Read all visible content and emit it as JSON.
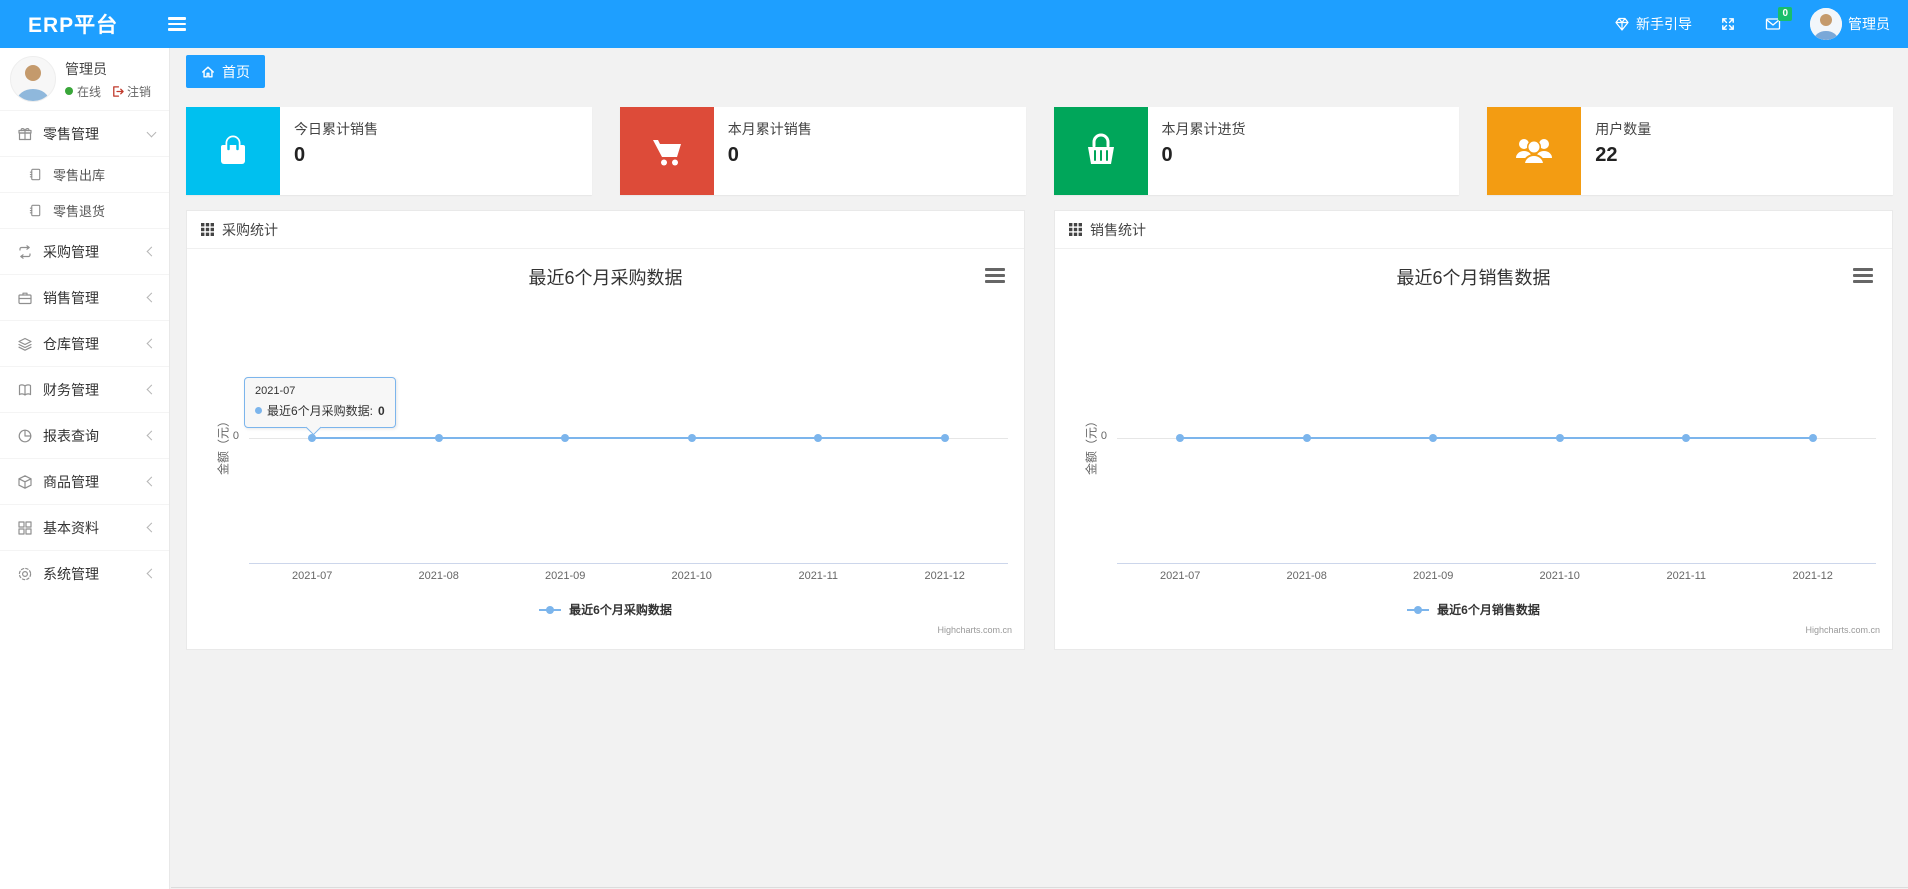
{
  "navbar": {
    "brand": "ERP平台",
    "guide_label": "新手引导",
    "message_badge": "0",
    "user_name": "管理员"
  },
  "sidebar": {
    "user": {
      "name": "管理员",
      "online_label": "在线",
      "logout_label": "注销"
    },
    "menu": [
      {
        "label": "零售管理",
        "icon": "gift-icon",
        "expanded": true
      },
      {
        "label": "零售出库",
        "icon": "document-icon"
      },
      {
        "label": "零售退货",
        "icon": "document-icon"
      },
      {
        "label": "采购管理",
        "icon": "repeat-icon"
      },
      {
        "label": "销售管理",
        "icon": "briefcase-icon"
      },
      {
        "label": "仓库管理",
        "icon": "layers-icon"
      },
      {
        "label": "财务管理",
        "icon": "book-icon"
      },
      {
        "label": "报表查询",
        "icon": "pie-chart-icon"
      },
      {
        "label": "商品管理",
        "icon": "package-icon"
      },
      {
        "label": "基本资料",
        "icon": "grid-icon"
      },
      {
        "label": "系统管理",
        "icon": "gear-icon"
      }
    ]
  },
  "tabs": {
    "home": "首页"
  },
  "stat_cards": [
    {
      "label": "今日累计销售",
      "value": "0",
      "color": "#00c0ef",
      "icon": "shopping-bag-icon"
    },
    {
      "label": "本月累计销售",
      "value": "0",
      "color": "#dd4b39",
      "icon": "shopping-cart-icon"
    },
    {
      "label": "本月累计进货",
      "value": "0",
      "color": "#00a65a",
      "icon": "shopping-basket-icon"
    },
    {
      "label": "用户数量",
      "value": "22",
      "color": "#f39c12",
      "icon": "users-icon"
    }
  ],
  "panels": [
    {
      "title": "采购统计"
    },
    {
      "title": "销售统计"
    }
  ],
  "chart_data": [
    {
      "type": "line",
      "title": "最近6个月采购数据",
      "categories": [
        "2021-07",
        "2021-08",
        "2021-09",
        "2021-10",
        "2021-11",
        "2021-12"
      ],
      "series": [
        {
          "name": "最近6个月采购数据",
          "values": [
            0,
            0,
            0,
            0,
            0,
            0
          ],
          "color": "#7cb5ec"
        }
      ],
      "ylabel": "金额（元）",
      "ytick": "0",
      "grid": true,
      "legend_position": "bottom",
      "credit": "Highcharts.com.cn",
      "tooltip": {
        "header": "2021-07",
        "series_label": "最近6个月采购数据: ",
        "value": "0"
      }
    },
    {
      "type": "line",
      "title": "最近6个月销售数据",
      "categories": [
        "2021-07",
        "2021-08",
        "2021-09",
        "2021-10",
        "2021-11",
        "2021-12"
      ],
      "series": [
        {
          "name": "最近6个月销售数据",
          "values": [
            0,
            0,
            0,
            0,
            0,
            0
          ],
          "color": "#7cb5ec"
        }
      ],
      "ylabel": "金额（元）",
      "ytick": "0",
      "grid": true,
      "legend_position": "bottom",
      "credit": "Highcharts.com.cn"
    }
  ]
}
